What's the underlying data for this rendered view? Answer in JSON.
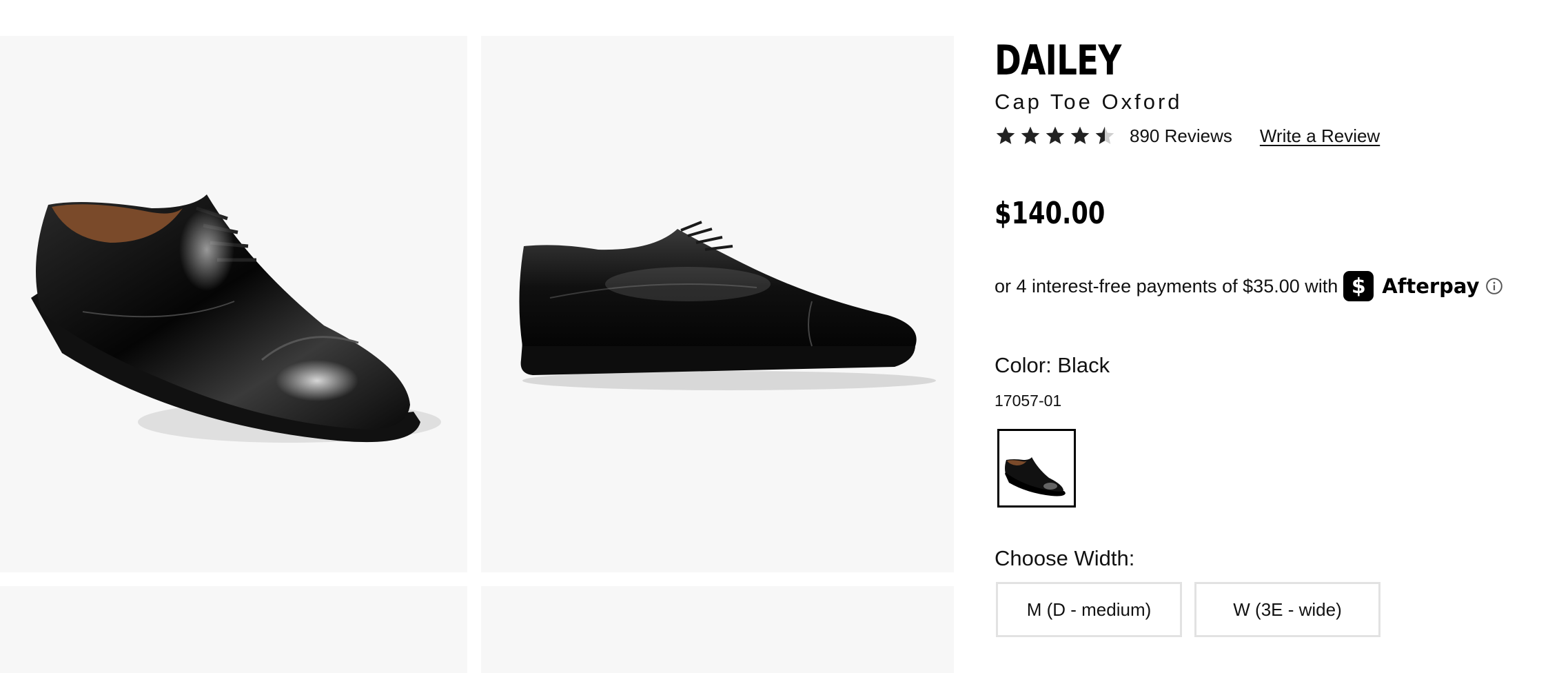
{
  "product": {
    "name": "DAILEY",
    "style": "Cap Toe Oxford",
    "rating": 4.5,
    "rating_max": 5,
    "reviews_text": "890 Reviews",
    "write_review_label": "Write a Review",
    "price": "$140.00"
  },
  "afterpay": {
    "text": "or 4 interest-free payments of $35.00 with",
    "badge_symbol": "$",
    "brand": "Afterpay",
    "info_icon": "info-circle-icon"
  },
  "color": {
    "label": "Color: Black",
    "sku": "17057-01"
  },
  "width": {
    "label": "Choose Width:",
    "options": [
      "M (D - medium)",
      "W (3E - wide)"
    ]
  },
  "colors": {
    "tile_bg": "#f7f7f7",
    "text": "#111111",
    "afterpay_badge": "#000000",
    "option_border": "#e2e2e2"
  },
  "icons": {
    "star": "star-icon",
    "half_star": "half-star-icon"
  }
}
